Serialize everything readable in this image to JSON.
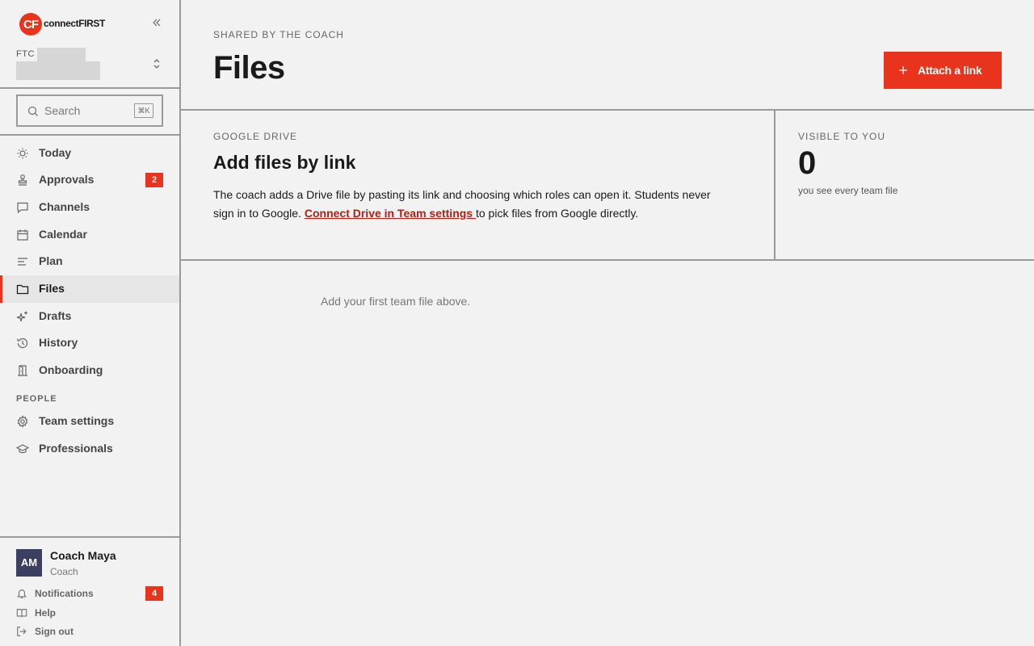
{
  "brand": {
    "mark": "CF",
    "name": "connectFIRST"
  },
  "team": {
    "prefix": "FTC"
  },
  "search": {
    "placeholder": "Search",
    "shortcut": "⌘K"
  },
  "nav": [
    {
      "label": "Today",
      "icon": "sun-icon"
    },
    {
      "label": "Approvals",
      "icon": "stamp-icon",
      "badge": "2"
    },
    {
      "label": "Channels",
      "icon": "chat-icon"
    },
    {
      "label": "Calendar",
      "icon": "calendar-icon"
    },
    {
      "label": "Plan",
      "icon": "lines-icon"
    },
    {
      "label": "Files",
      "icon": "folder-icon",
      "active": true
    },
    {
      "label": "Drafts",
      "icon": "sparkle-icon"
    },
    {
      "label": "History",
      "icon": "history-icon"
    },
    {
      "label": "Onboarding",
      "icon": "door-icon"
    }
  ],
  "people_section": "PEOPLE",
  "people_nav": [
    {
      "label": "Team settings",
      "icon": "gear-icon"
    },
    {
      "label": "Professionals",
      "icon": "graduation-cap-icon"
    }
  ],
  "user": {
    "initials": "AM",
    "name": "Coach Maya",
    "role": "Coach"
  },
  "footer": [
    {
      "label": "Notifications",
      "icon": "bell-icon",
      "badge": "4"
    },
    {
      "label": "Help",
      "icon": "book-icon"
    },
    {
      "label": "Sign out",
      "icon": "sign-out-icon"
    }
  ],
  "header": {
    "eyebrow": "SHARED BY THE COACH",
    "title": "Files",
    "action": "Attach a link"
  },
  "drive_card": {
    "eyebrow": "GOOGLE DRIVE",
    "title": "Add files by link",
    "body_before": "The coach adds a Drive file by pasting its link and choosing which roles can open it. Students never sign in to Google. ",
    "link": "Connect Drive in Team settings ",
    "body_after": "to pick files from Google directly."
  },
  "visible_card": {
    "eyebrow": "VISIBLE TO YOU",
    "count": "0",
    "sub": "you see every team file"
  },
  "empty_state": "Add your first team file above.",
  "colors": {
    "accent": "#e8341c",
    "link": "#b5200e",
    "avatar": "#3c4060"
  }
}
